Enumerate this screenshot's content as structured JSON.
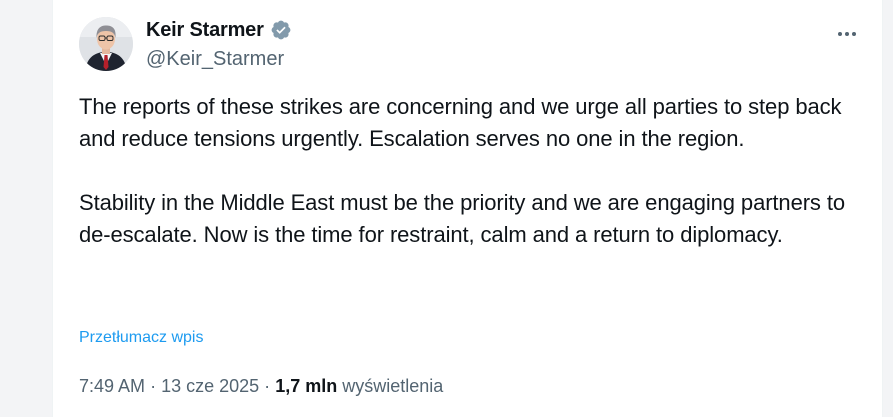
{
  "author": {
    "display_name": "Keir Starmer",
    "handle": "@Keir_Starmer",
    "verified": true,
    "avatar_icon": "profile-photo",
    "verified_icon": "verified-badge-icon"
  },
  "header": {
    "more_icon": "more-horizontal-icon"
  },
  "tweet": {
    "paragraphs": [
      "The reports of these strikes are concerning and we urge all parties to step back and reduce tensions urgently. Escalation serves no one in the region.",
      "Stability in the Middle East must be the priority and we are engaging partners to de-escalate. Now is the time for restraint, calm and a return to diplomacy."
    ],
    "translate_label": "Przetłumacz wpis"
  },
  "meta": {
    "time": "7:49 AM",
    "separator": "·",
    "date": "13 cze 2025",
    "views_count": "1,7 mln",
    "views_label": "wyświetlenia"
  },
  "colors": {
    "text_primary": "#0f1419",
    "text_secondary": "#536471",
    "link": "#1d9bf0",
    "verified_fill": "#829aab"
  }
}
